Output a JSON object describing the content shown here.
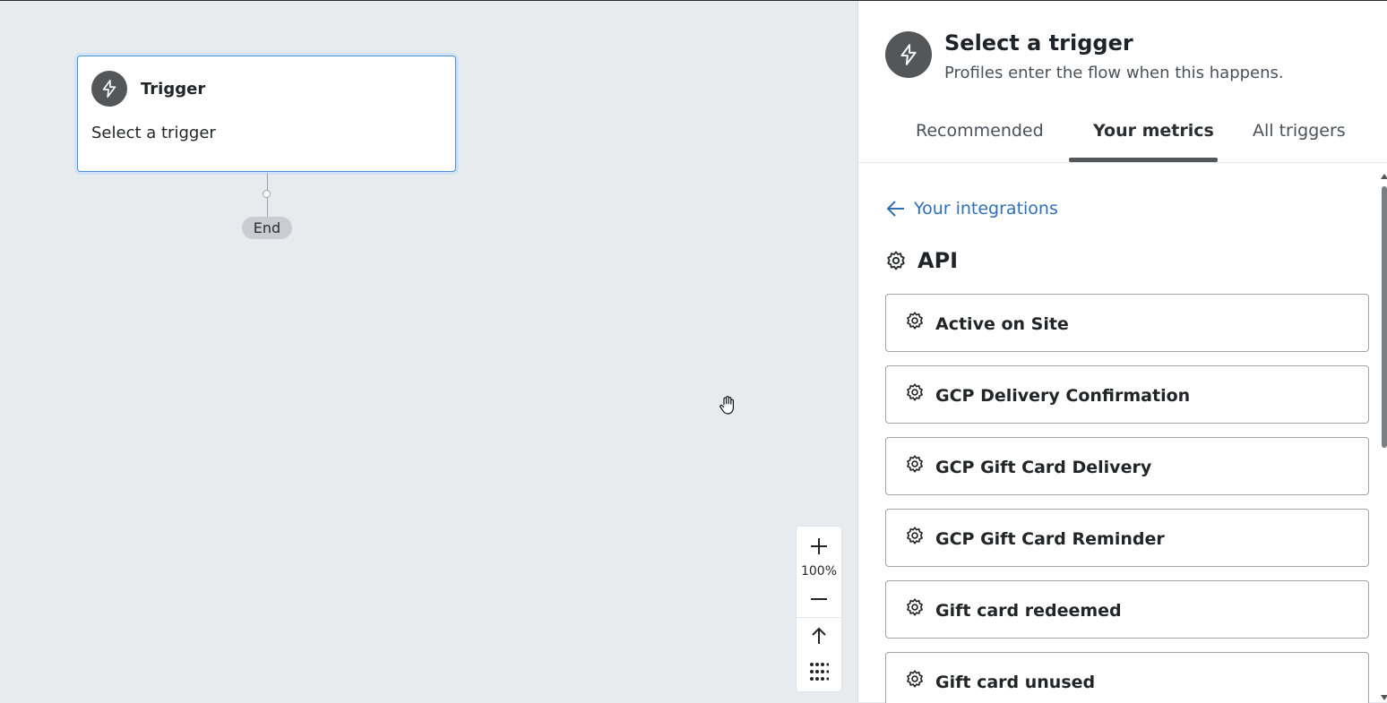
{
  "canvas": {
    "trigger_card": {
      "title": "Trigger",
      "subtitle": "Select a trigger"
    },
    "end_label": "End",
    "zoom": {
      "level": "100%"
    }
  },
  "panel": {
    "title": "Select a trigger",
    "subtitle": "Profiles enter the flow when this happens.",
    "tabs": [
      {
        "label": "Recommended",
        "active": false
      },
      {
        "label": "Your metrics",
        "active": true
      },
      {
        "label": "All triggers",
        "active": false
      }
    ],
    "back_link": "Your integrations",
    "section": {
      "label": "API",
      "icon": "gear-icon"
    },
    "metrics": [
      {
        "label": "Active on Site",
        "icon": "gear-icon"
      },
      {
        "label": "GCP Delivery Confirmation",
        "icon": "gear-icon"
      },
      {
        "label": "GCP Gift Card Delivery",
        "icon": "gear-icon"
      },
      {
        "label": "GCP Gift Card Reminder",
        "icon": "gear-icon"
      },
      {
        "label": "Gift card redeemed",
        "icon": "gear-icon"
      },
      {
        "label": "Gift card unused",
        "icon": "gear-icon"
      }
    ]
  },
  "colors": {
    "canvas_bg": "#e8ebee",
    "accent_link": "#2f6fb5",
    "icon_circle": "#545657",
    "selected_border": "#4a90d9"
  }
}
